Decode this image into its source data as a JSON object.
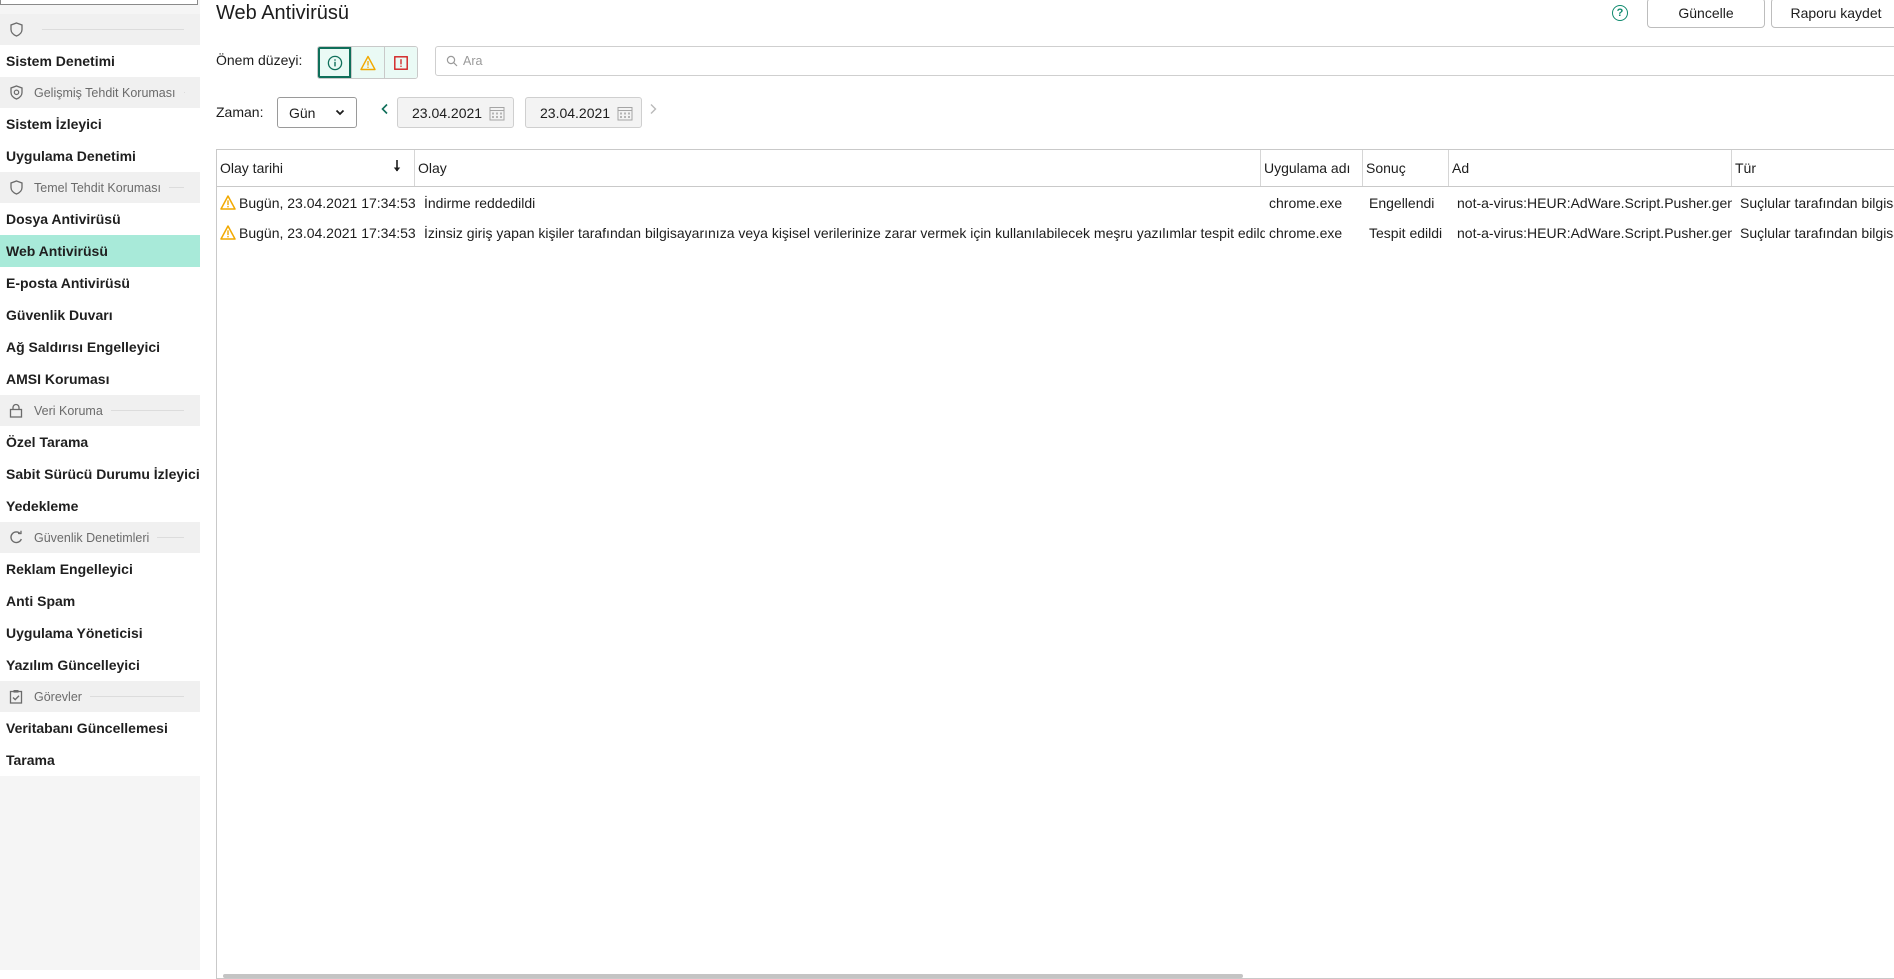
{
  "sidebar": {
    "sections": [
      {
        "header": "",
        "icon": "shield-icon",
        "items": [
          "Sistem Denetimi"
        ]
      },
      {
        "header": "Gelişmiş Tehdit Koruması",
        "icon": "shield-gear-icon",
        "items": [
          "Sistem İzleyici",
          "Uygulama Denetimi"
        ]
      },
      {
        "header": "Temel Tehdit Koruması",
        "icon": "shield-icon",
        "items": [
          "Dosya Antivirüsü",
          "Web Antivirüsü",
          "E-posta Antivirüsü",
          "Güvenlik Duvarı",
          "Ağ Saldırısı Engelleyici",
          "AMSI Koruması"
        ]
      },
      {
        "header": "Veri Koruma",
        "icon": "lock-icon",
        "items": [
          "Özel Tarama",
          "Sabit Sürücü Durumu İzleyici",
          "Yedekleme"
        ]
      },
      {
        "header": "Güvenlik Denetimleri",
        "icon": "refresh-icon",
        "items": [
          "Reklam Engelleyici",
          "Anti Spam",
          "Uygulama Yöneticisi",
          "Yazılım Güncelleyici"
        ]
      },
      {
        "header": "Görevler",
        "icon": "clipboard-check-icon",
        "items": [
          "Veritabanı Güncellemesi",
          "Tarama"
        ]
      }
    ],
    "active_item": "Web Antivirüsü"
  },
  "header": {
    "title": "Web Antivirüsü",
    "update_button": "Güncelle",
    "save_report_button": "Raporu kaydet"
  },
  "filters": {
    "severity_label": "Önem düzeyi:",
    "search_placeholder": "Ara",
    "time_label": "Zaman:",
    "period": "Gün",
    "date_start": "23.04.2021",
    "date_end": "23.04.2021"
  },
  "table": {
    "columns": [
      "Olay tarihi",
      "Olay",
      "Uygulama adı",
      "Sonuç",
      "Ad",
      "Tür"
    ],
    "rows": [
      {
        "severity": "warning",
        "date": "Bugün, 23.04.2021 17:34:53",
        "event": "İndirme reddedildi",
        "app": "chrome.exe",
        "result": "Engellendi",
        "name": "not-a-virus:HEUR:AdWare.Script.Pusher.gen",
        "type": "Suçlular tarafından bilgisayarınıza"
      },
      {
        "severity": "warning",
        "date": "Bugün, 23.04.2021 17:34:53",
        "event": "İzinsiz giriş yapan kişiler tarafından bilgisayarınıza veya kişisel verilerinize zarar vermek için kullanılabilecek meşru yazılımlar tespit edildi.",
        "app": "chrome.exe",
        "result": "Tespit edildi",
        "name": "not-a-virus:HEUR:AdWare.Script.Pusher.gen",
        "type": "Suçlular tarafından bilgisayarınıza"
      }
    ]
  },
  "colors": {
    "accent": "#0f6f5a",
    "active_item_bg": "#a8ead9",
    "warning": "#f2a900",
    "error": "#d21f1f"
  }
}
